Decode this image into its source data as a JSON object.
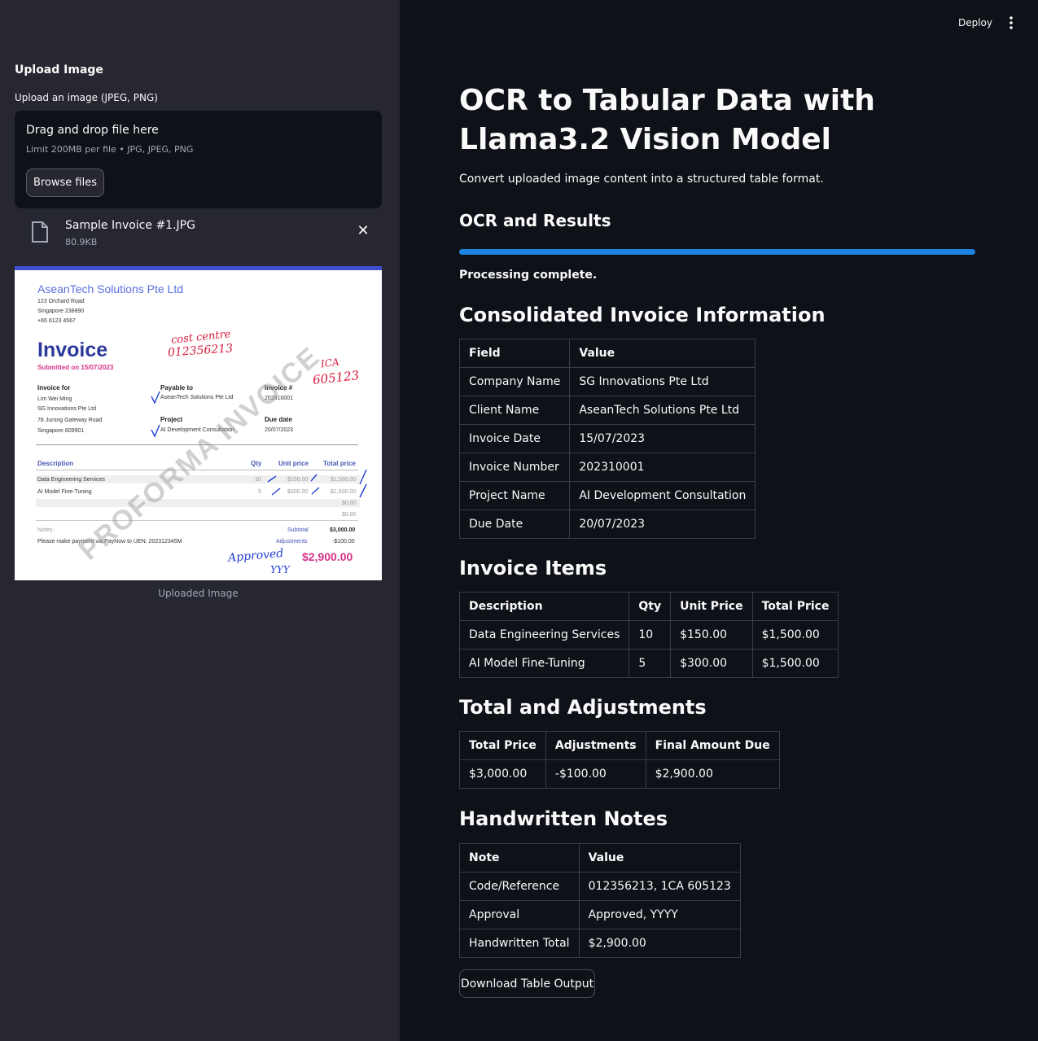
{
  "sidebar": {
    "title": "Upload Image",
    "uploader_label": "Upload an image (JPEG, PNG)",
    "dropzone_text": "Drag and drop file here",
    "dropzone_limit": "Limit 200MB per file • JPG, JPEG, PNG",
    "browse_label": "Browse files",
    "file": {
      "name": "Sample Invoice #1.JPG",
      "size": "80.9KB"
    },
    "close_glyph": "✕",
    "caption": "Uploaded Image"
  },
  "invoice_image": {
    "company": "AseanTech Solutions Pte Ltd",
    "address": [
      "123 Orchard Road",
      "Singapore 238890",
      "+65 6123 4567"
    ],
    "title": "Invoice",
    "submitted": "Submitted on 15/07/2023",
    "invoice_for_h": "Invoice for",
    "invoice_for": [
      "Lim Wei Ming",
      "SG Innovations Pte Ltd",
      "78 Jurong Gateway Road",
      "Singapore 609901"
    ],
    "payable_h": "Payable to",
    "payable": "AseanTech Solutions Pte Ltd",
    "invno_h": "Invoice #",
    "invno": "202310001",
    "project_h": "Project",
    "project": "AI Development Consultation",
    "due_h": "Due date",
    "due": "20/07/2023",
    "col_desc": "Description",
    "col_qty": "Qty",
    "col_unit": "Unit price",
    "col_total": "Total price",
    "rows": [
      {
        "desc": "Data Engineering Services",
        "qty": "10",
        "unit": "$150.00",
        "total": "$1,500.00"
      },
      {
        "desc": "AI Model Fine-Tuning",
        "qty": "5",
        "unit": "$300.00",
        "total": "$1,500.00"
      },
      {
        "desc": "",
        "qty": "",
        "unit": "",
        "total": "$0.00"
      },
      {
        "desc": "",
        "qty": "",
        "unit": "",
        "total": "$0.00"
      }
    ],
    "notes_h": "Notes:",
    "notes": "Please make payment via PayNow to UEN: 202312345M",
    "subtotal_h": "Subtotal",
    "subtotal": "$3,000.00",
    "adjust_h": "Adjustments",
    "adjust": "-$100.00",
    "grand_total": "$2,900.00",
    "watermark": "PROFORMA INVOICE",
    "hand_cost_centre": "cost centre",
    "hand_code": "012356213",
    "hand_ica": "ICA",
    "hand_ica_no": "605123",
    "hand_approved": "Approved",
    "hand_initials": "YYY"
  },
  "header": {
    "deploy_label": "Deploy"
  },
  "main": {
    "title": "OCR to Tabular Data with Llama3.2 Vision Model",
    "description": "Convert uploaded image content into a structured table format.",
    "ocr_heading": "OCR and Results",
    "progress": 1.0,
    "status": "Processing complete.",
    "consolidated": {
      "heading": "Consolidated Invoice Information",
      "headers": [
        "Field",
        "Value"
      ],
      "rows": [
        [
          "Company Name",
          "SG Innovations Pte Ltd"
        ],
        [
          "Client Name",
          "AseanTech Solutions Pte Ltd"
        ],
        [
          "Invoice Date",
          "15/07/2023"
        ],
        [
          "Invoice Number",
          "202310001"
        ],
        [
          "Project Name",
          "AI Development Consultation"
        ],
        [
          "Due Date",
          "20/07/2023"
        ]
      ]
    },
    "items": {
      "heading": "Invoice Items",
      "headers": [
        "Description",
        "Qty",
        "Unit Price",
        "Total Price"
      ],
      "rows": [
        [
          "Data Engineering Services",
          "10",
          "$150.00",
          "$1,500.00"
        ],
        [
          "AI Model Fine-Tuning",
          "5",
          "$300.00",
          "$1,500.00"
        ]
      ]
    },
    "totals": {
      "heading": "Total and Adjustments",
      "headers": [
        "Total Price",
        "Adjustments",
        "Final Amount Due"
      ],
      "rows": [
        [
          "$3,000.00",
          "-$100.00",
          "$2,900.00"
        ]
      ]
    },
    "notes": {
      "heading": "Handwritten Notes",
      "headers": [
        "Note",
        "Value"
      ],
      "rows": [
        [
          "Code/Reference",
          "012356213, 1CA 605123"
        ],
        [
          "Approval",
          "Approved, YYYY"
        ],
        [
          "Handwritten Total",
          "$2,900.00"
        ]
      ]
    },
    "download_label": "Download Table Output"
  },
  "colors": {
    "accent": "#1c83e1",
    "sidebar_bg": "#262730",
    "main_bg": "#0e1117"
  }
}
